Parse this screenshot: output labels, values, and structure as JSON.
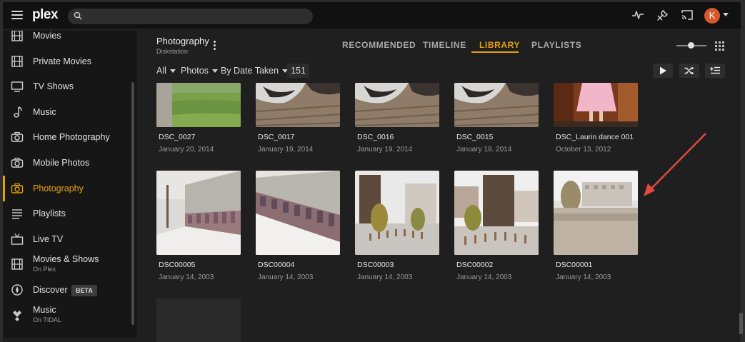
{
  "app": {
    "logo_text": "plex",
    "logo_accent": "#e5a00d"
  },
  "search": {
    "placeholder": "",
    "value": ""
  },
  "user": {
    "avatar_initial": "K",
    "avatar_color": "#d6582d"
  },
  "sidebar": {
    "items": [
      {
        "label": "Movies",
        "icon": "film-icon"
      },
      {
        "label": "Private Movies",
        "icon": "film-icon"
      },
      {
        "label": "TV Shows",
        "icon": "tv-icon"
      },
      {
        "label": "Music",
        "icon": "music-note-icon"
      },
      {
        "label": "Home Photography",
        "icon": "camera-icon"
      },
      {
        "label": "Mobile Photos",
        "icon": "camera-icon"
      },
      {
        "label": "Photography",
        "icon": "camera-icon",
        "active": true
      },
      {
        "label": "Playlists",
        "icon": "playlist-icon"
      },
      {
        "label": "Live TV",
        "icon": "tv-antenna-icon"
      },
      {
        "label": "Movies & Shows",
        "sub": "On Plex",
        "icon": "film-icon"
      },
      {
        "label": "Discover",
        "badge": "BETA",
        "icon": "compass-icon"
      },
      {
        "label": "Music",
        "sub": "On TIDAL",
        "icon": "tidal-icon"
      }
    ]
  },
  "library": {
    "title": "Photography",
    "subtitle": "Diskstation"
  },
  "tabs": [
    {
      "label": "RECOMMENDED"
    },
    {
      "label": "TIMELINE"
    },
    {
      "label": "LIBRARY",
      "active": true
    },
    {
      "label": "PLAYLISTS"
    }
  ],
  "filters": {
    "all": "All",
    "type": "Photos",
    "sort": "By Date Taken",
    "count": "151"
  },
  "photos": [
    {
      "name": "DSC_0027",
      "date": "January 20, 2014"
    },
    {
      "name": "DSC_0017",
      "date": "January 19, 2014"
    },
    {
      "name": "DSC_0016",
      "date": "January 19, 2014"
    },
    {
      "name": "DSC_0015",
      "date": "January 19, 2014"
    },
    {
      "name": "DSC_Laurin dance 001",
      "date": "October 13, 2012"
    },
    {
      "name": "DSC00005",
      "date": "January 14, 2003"
    },
    {
      "name": "DSC00004",
      "date": "January 14, 2003"
    },
    {
      "name": "DSC00003",
      "date": "January 14, 2003"
    },
    {
      "name": "DSC00002",
      "date": "January 14, 2003"
    },
    {
      "name": "DSC00001",
      "date": "January 14, 2003"
    }
  ],
  "colors": {
    "accent": "#e5a00d",
    "annotation_arrow": "#e04a3a"
  }
}
